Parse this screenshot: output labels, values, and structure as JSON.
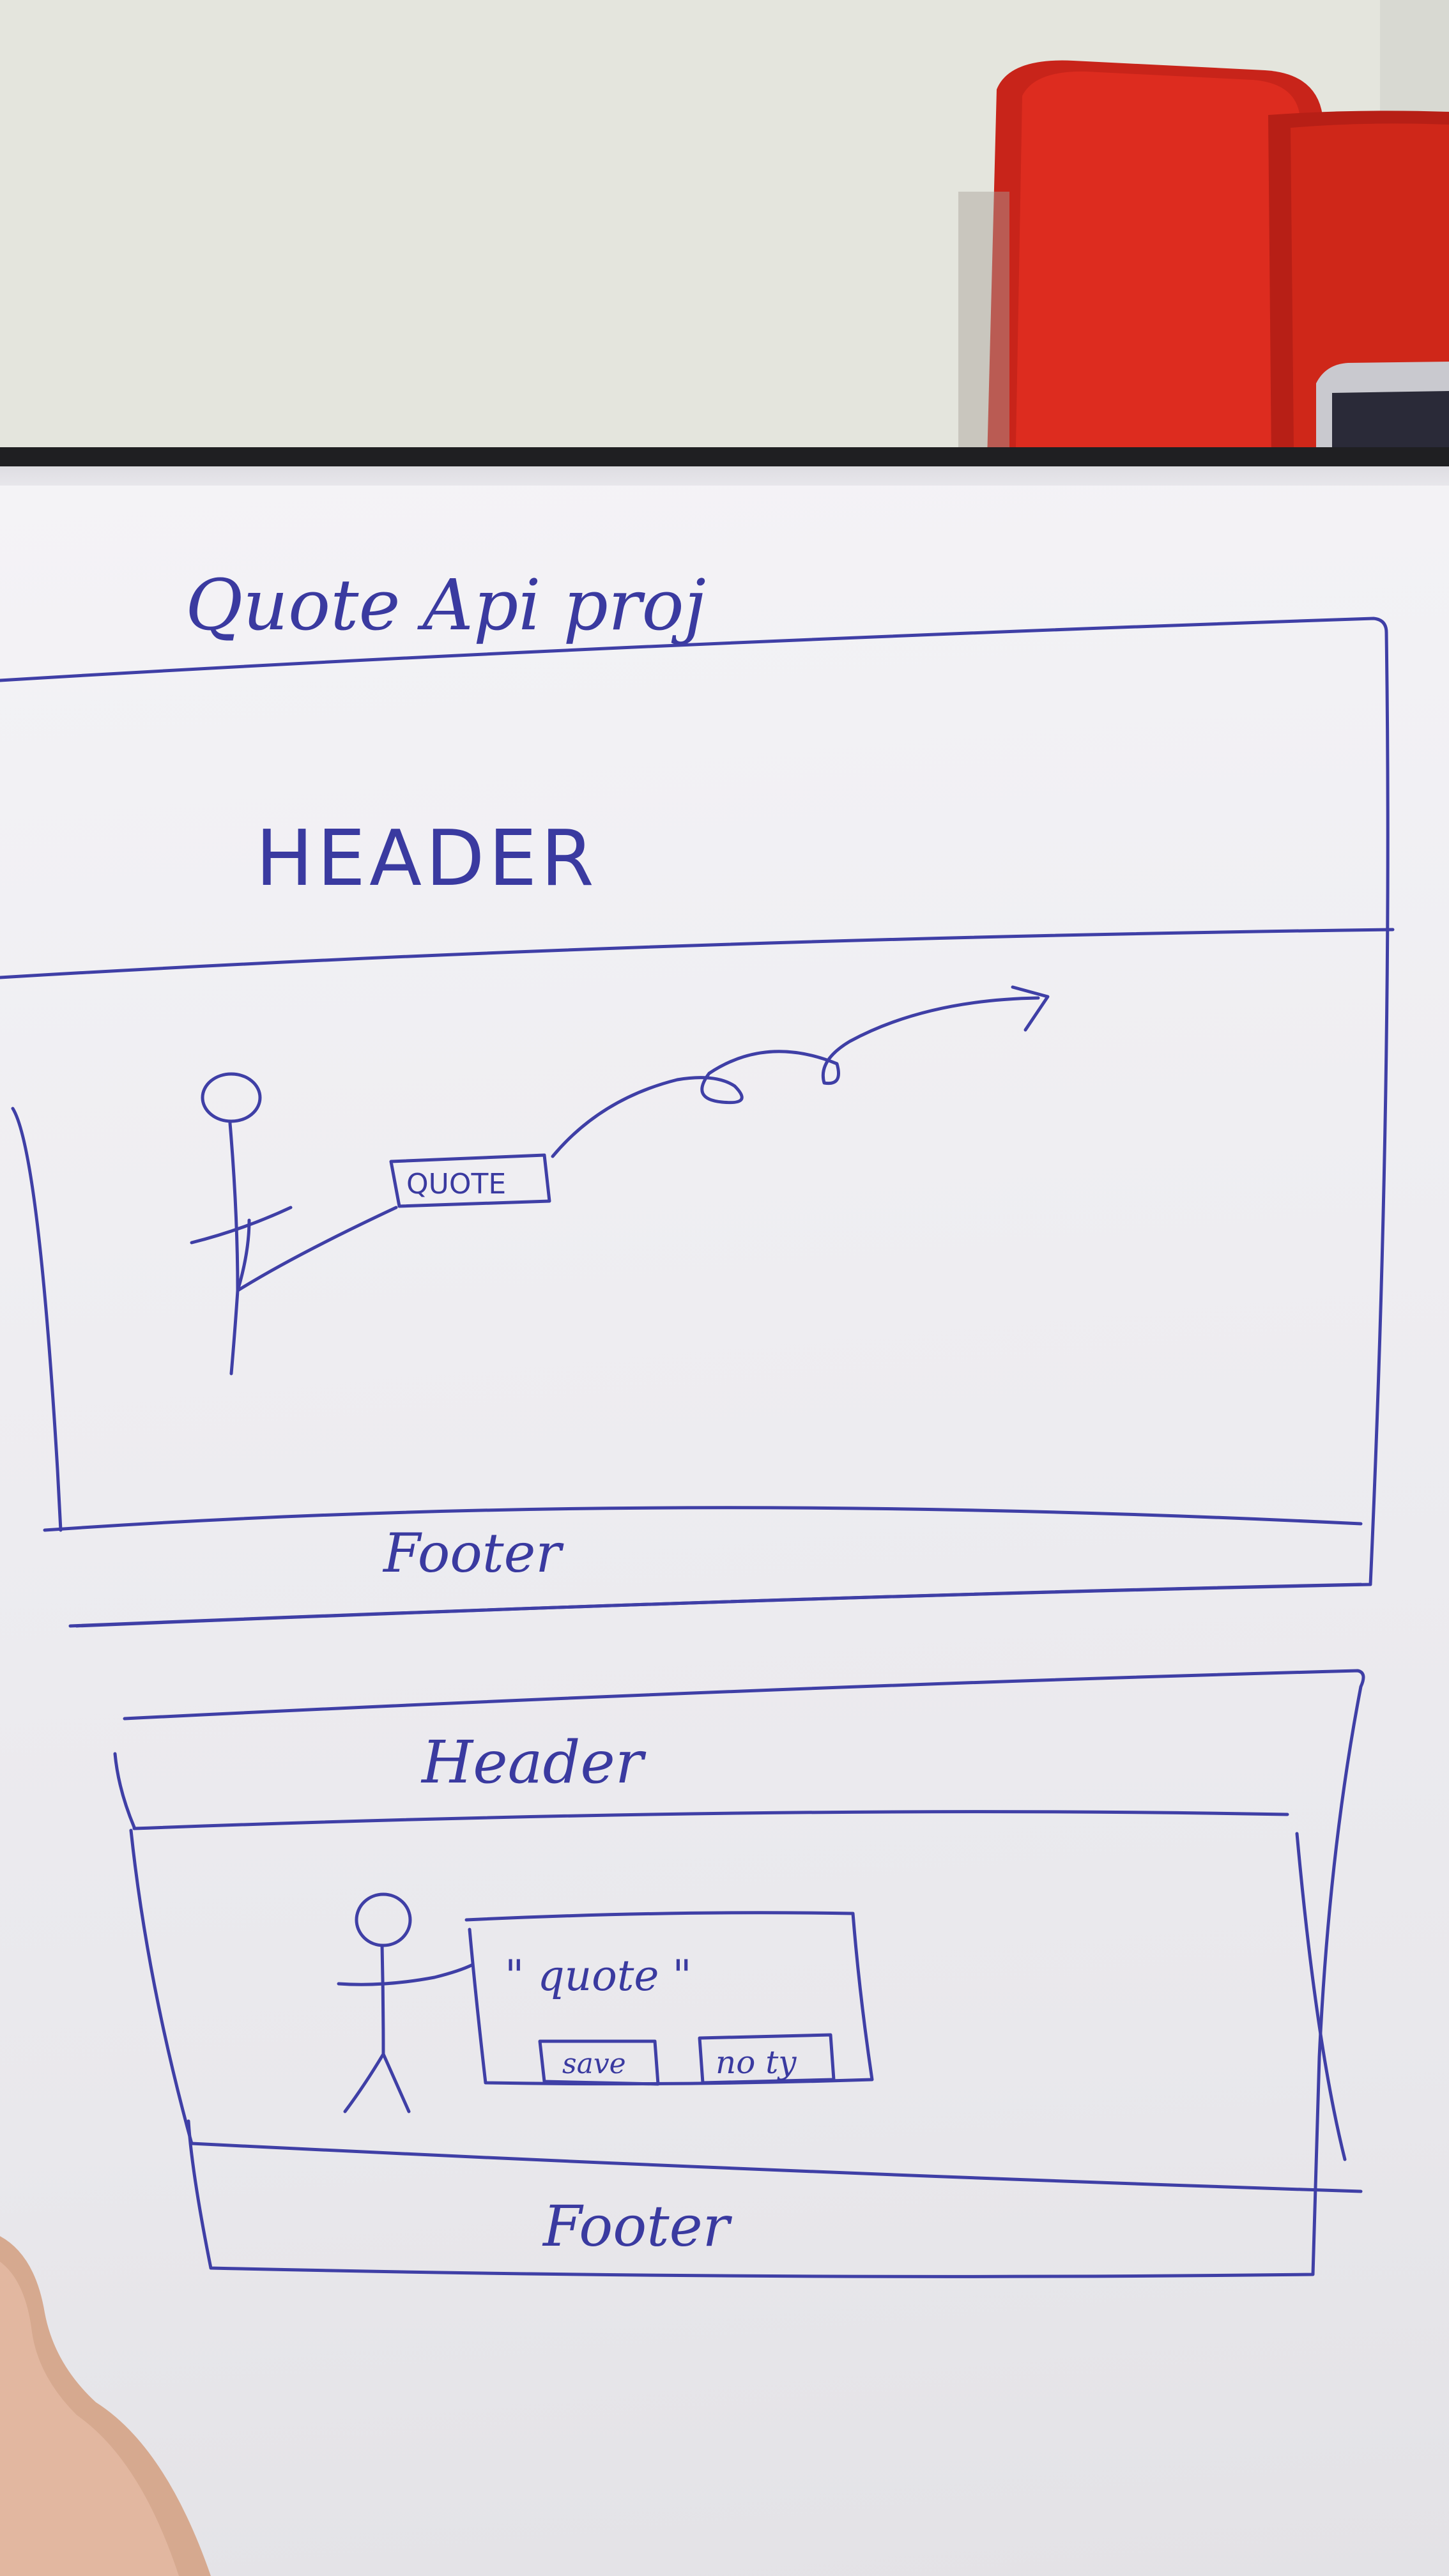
{
  "sketch": {
    "title": "Quote Api proj",
    "wireframe_1": {
      "header": "HEADER",
      "button": "QUOTE",
      "footer": "Footer"
    },
    "wireframe_2": {
      "header": "Header",
      "quote_text": "\" quote \"",
      "save_button": "save",
      "decline_button": "no ty",
      "footer": "Footer"
    }
  },
  "colors": {
    "ink": "#3f3fa6",
    "paper": "#f1f0f4",
    "chair": "#d42a1c",
    "binder": "#1f1f22",
    "wall": "#e4e5dd"
  }
}
